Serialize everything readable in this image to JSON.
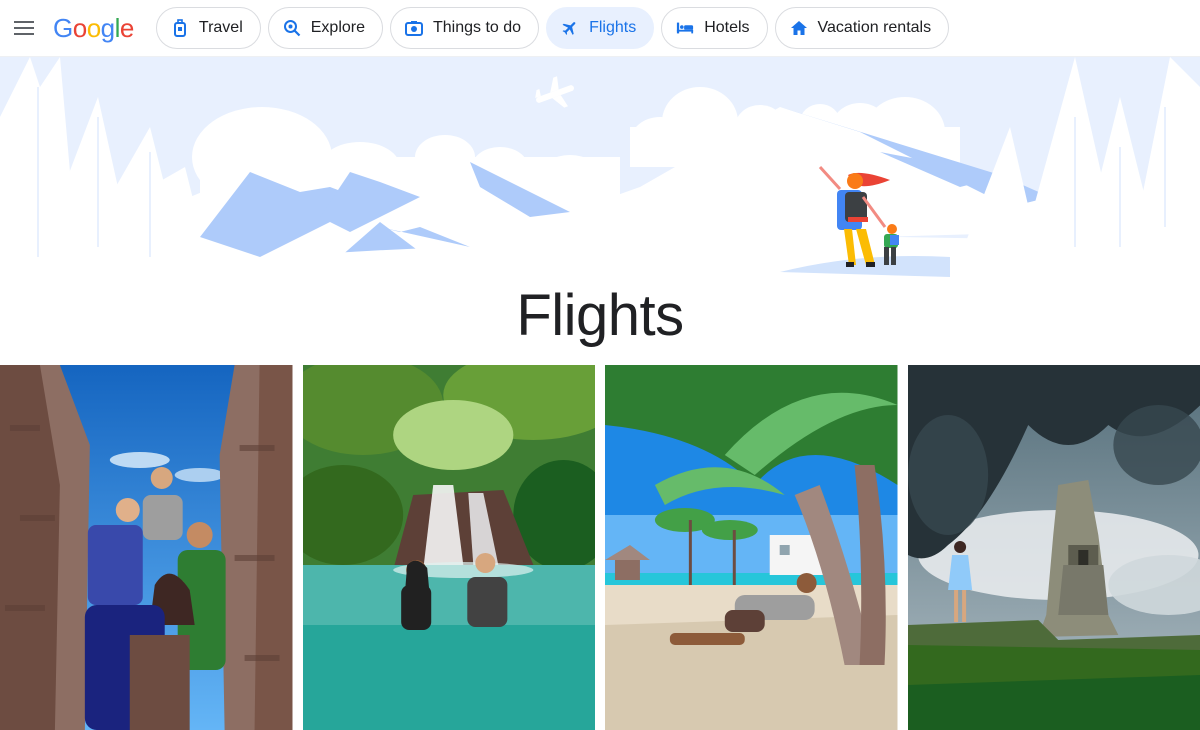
{
  "header": {
    "menu_icon": "hamburger-menu-icon",
    "logo": {
      "letters": [
        "G",
        "o",
        "o",
        "g",
        "l",
        "e"
      ],
      "colors": [
        "#4285F4",
        "#EA4335",
        "#FBBC05",
        "#4285F4",
        "#34A853",
        "#EA4335"
      ]
    },
    "tabs": [
      {
        "label": "Travel",
        "icon": "luggage-icon",
        "active": false
      },
      {
        "label": "Explore",
        "icon": "explore-search-icon",
        "active": false
      },
      {
        "label": "Things to do",
        "icon": "camera-icon",
        "active": false
      },
      {
        "label": "Flights",
        "icon": "airplane-icon",
        "active": true
      },
      {
        "label": "Hotels",
        "icon": "bed-icon",
        "active": false
      },
      {
        "label": "Vacation rentals",
        "icon": "home-icon",
        "active": false
      }
    ]
  },
  "hero": {
    "illustration": "mountains-with-hiker-and-child-illustration",
    "sky_color": "#e8f0fe",
    "mountain_color": "#aecbfa"
  },
  "main": {
    "title": "Flights"
  },
  "photos": [
    {
      "subject": "group-of-friends-between-stone-walls-photo"
    },
    {
      "subject": "two-people-in-waterfall-pool-photo"
    },
    {
      "subject": "man-relaxing-under-palm-tree-beach-photo"
    },
    {
      "subject": "woman-facing-mayan-temple-ruins-photo"
    }
  ],
  "colors": {
    "accent": "#1a73e8",
    "active_tab_bg": "#e8f0fe",
    "text": "#202124",
    "border": "#dadce0"
  }
}
